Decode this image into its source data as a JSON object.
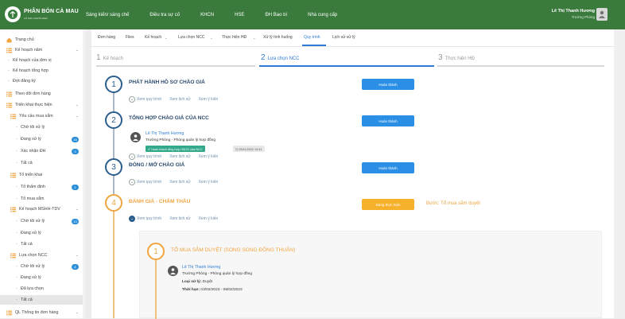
{
  "brand": {
    "name": "PHÂN BÓN CÀ MAU",
    "sub": "CÀ MAU FERTILIZER"
  },
  "topnav": [
    "Sáng kiến/ sáng chế",
    "Điều tra sự cố",
    "KHCN",
    "HSE",
    "ĐH Bao bì",
    "Nhà cung cấp"
  ],
  "user": {
    "name": "Lê Thị Thanh Hương",
    "role": "Trưởng Phòng"
  },
  "sidebar": [
    {
      "label": "Trang chủ",
      "icon": "home-icon"
    },
    {
      "label": "Kế hoạch năm",
      "icon": "list-icon"
    },
    {
      "label": "Kế hoạch của đơn vị"
    },
    {
      "label": "Kế hoạch tổng hợp"
    },
    {
      "label": "Đợt đăng ký"
    },
    {
      "label": "Theo dõi đơn hàng",
      "icon": "list-icon"
    },
    {
      "label": "Triển khai thực hiện",
      "icon": "list-icon"
    },
    {
      "label": "Yêu cầu mua sắm",
      "icon": "list-icon"
    },
    {
      "label": "Chờ tôi xử lý"
    },
    {
      "label": "Đang xử lý",
      "badge": "16"
    },
    {
      "label": "Xác nhận ĐH",
      "badge": "3"
    },
    {
      "label": "Tất cả"
    },
    {
      "label": "Tổ triển khai",
      "icon": "list-icon"
    },
    {
      "label": "Tổ thẩm định",
      "badge": "1"
    },
    {
      "label": "Tổ mua sắm"
    },
    {
      "label": "Kế hoạch MSHH-TDV",
      "icon": "list-icon"
    },
    {
      "label": "Chờ tôi xử lý",
      "badge": "13"
    },
    {
      "label": "Đang xử lý"
    },
    {
      "label": "Tất cả"
    },
    {
      "label": "Lựa chọn NCC",
      "icon": "list-icon"
    },
    {
      "label": "Chờ tôi xử lý",
      "badge": "8"
    },
    {
      "label": "Đang xử lý"
    },
    {
      "label": "Đã lựa chọn"
    },
    {
      "label": "Tất cả"
    },
    {
      "label": "QL Thông tin đơn hàng",
      "icon": "list-icon"
    }
  ],
  "tabs": [
    "Đơn hàng",
    "Files",
    "Kế hoạch",
    "Lựa chọn NCC",
    "Thực hiện HĐ",
    "Xử lý tình huống",
    "Quy trình",
    "Lịch sử xử lý"
  ],
  "steps": [
    {
      "num": "1",
      "label": "Kế hoạch"
    },
    {
      "num": "2",
      "label": "Lựa chọn NCC"
    },
    {
      "num": "3",
      "label": "Thực hiện HĐ"
    }
  ],
  "stages": [
    {
      "num": "1",
      "title": "PHÁT HÀNH HỒ SƠ CHÀO GIÁ",
      "button": "Hoàn thành"
    },
    {
      "num": "2",
      "title": "TỔNG HỢP CHÀO GIÁ CỦA NCC",
      "button": "Hoàn thành"
    },
    {
      "num": "3",
      "title": "ĐÓNG / MỞ CHÀO GIÁ",
      "button": "Hoàn thành"
    },
    {
      "num": "4",
      "title": "ĐÁNH GIÁ - CHẤM THẦU",
      "button": "Đang thực hiện"
    }
  ],
  "links": {
    "view": "Xem quy trình",
    "history": "Xem lịch sử",
    "opinion": "Xem ý kiến"
  },
  "stage2": {
    "person": "Lê Thị Thanh Hương",
    "role": "Trưởng Phòng - Phòng quản lý hợp đồng",
    "tag": "✔ Hoàn thành tổng hợp HSCG của NCC",
    "date": "◷ 25/11/2022 13:41"
  },
  "stage4_note": "Bước: Tổ mua sắm duyệt",
  "sub": {
    "num": "1",
    "title": "TỔ MUA SẮM DUYỆT (SONG SONG ĐỒNG THUẬN)",
    "person": "Lê Thị Thanh Hương",
    "role": "Trưởng Phòng - Phòng quản lý hợp đồng",
    "type_label": "Loại xử lý:",
    "type_value": "Duyệt",
    "time_label": "Thời hạn:",
    "time_value": "03/02/2023 - 08/02/2023"
  },
  "colors": {
    "header": "#3a7a3d",
    "primary": "#2b8fe6",
    "warning": "#f6b02a",
    "accent_orange": "#f0a541"
  }
}
